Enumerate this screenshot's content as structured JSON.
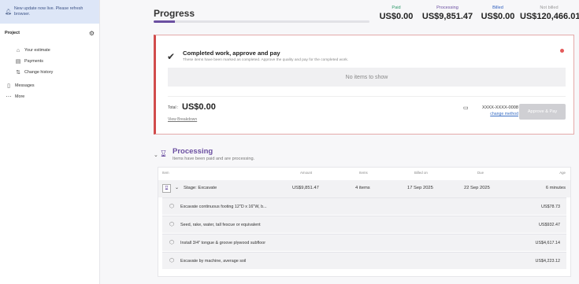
{
  "sidebar": {
    "banner": "New update now live. Please refresh browser.",
    "section_label": "Project",
    "items": [
      {
        "label": "Your estimate",
        "icon": "house-icon"
      },
      {
        "label": "Payments",
        "icon": "cash-icon"
      },
      {
        "label": "Change history",
        "icon": "history-icon"
      }
    ],
    "messages": "Messages",
    "more": "More"
  },
  "progress": {
    "title": "Progress",
    "fill_percent": 10
  },
  "stats": {
    "paid": {
      "label": "Paid",
      "value": "US$0.00",
      "color": "#2e9a6a"
    },
    "processing": {
      "label": "Processing",
      "value": "US$9,851.47",
      "color": "#6b4fa1"
    },
    "billed": {
      "label": "Billed",
      "value": "US$0.00",
      "color": "#2f5fbf"
    },
    "not_billed": {
      "label": "Not billed",
      "value": "US$120,466.01",
      "color": "#999999"
    }
  },
  "completed": {
    "title": "Completed work, approve and pay",
    "subtitle": "These items have been marked as completed. Approve the quality and pay for the completed work.",
    "empty_text": "No items to show",
    "total_label": "Total :",
    "total_value": "US$0.00",
    "breakdown_link": "View Breakdown",
    "card_number": "XXXX-XXXX-0008",
    "change_method": "change method",
    "approve_button": "Approve & Pay"
  },
  "processing": {
    "title": "Processing",
    "subtitle": "Items have been paid and are processing.",
    "columns": [
      "Item",
      "Amount",
      "Items",
      "Billed on",
      "Due",
      "Age"
    ],
    "stage": {
      "name": "Stage: Excavate",
      "amount": "US$9,851.47",
      "items": "4 items",
      "billed_on": "17 Sep 2025",
      "due": "22 Sep 2025",
      "age": "6 minutes"
    },
    "line_items": [
      {
        "name": "Excavate continuous footing 12\"D x 16\"W, b...",
        "value": "US$78.73"
      },
      {
        "name": "Seed, rake, water, tall fescue or equivalent",
        "value": "US$932.47"
      },
      {
        "name": "Install 3/4\" tongue & groove plywood subfloor",
        "value": "US$4,617.14"
      },
      {
        "name": "Excavate by machine, average soil",
        "value": "US$4,223.12"
      }
    ]
  }
}
